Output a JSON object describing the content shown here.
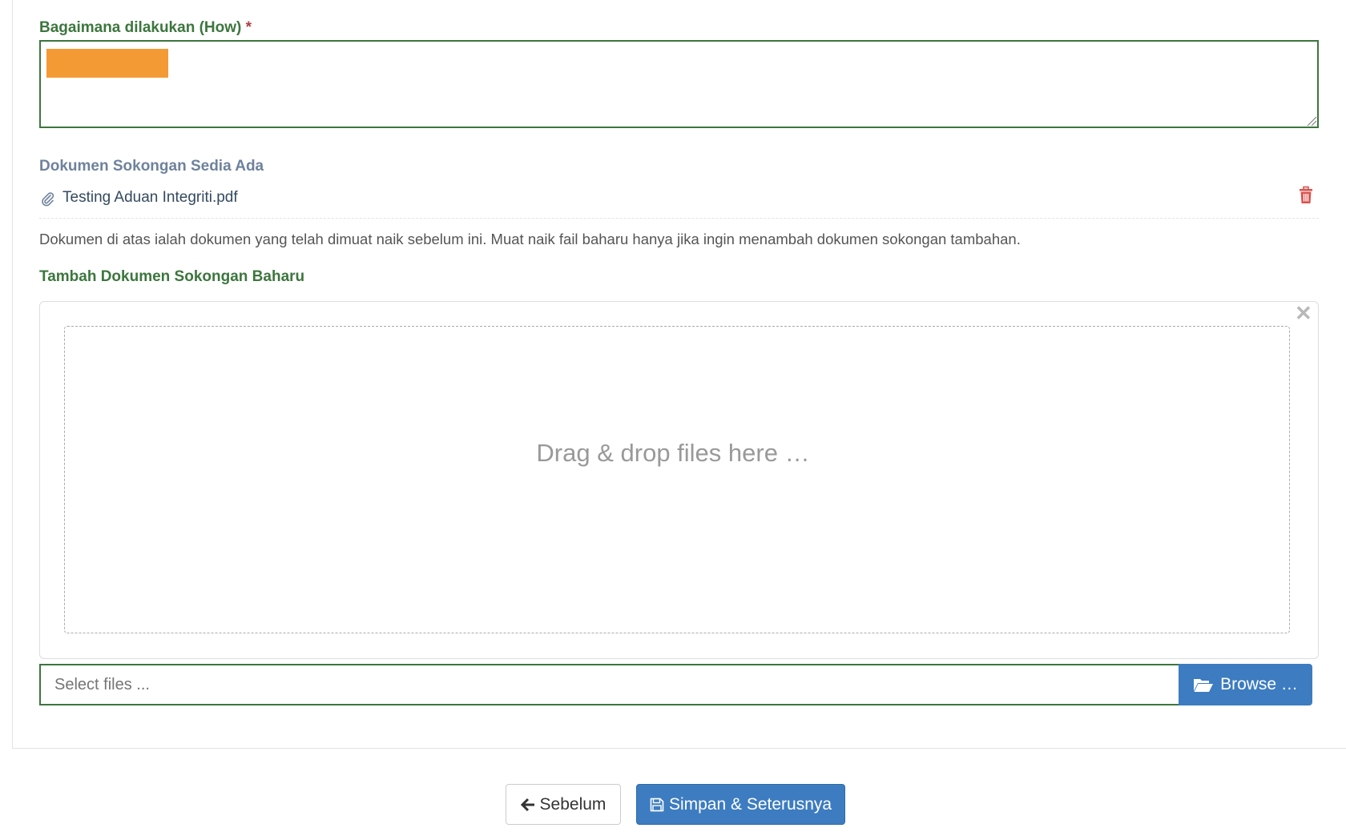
{
  "how_field": {
    "label": "Bagaimana dilakukan (How)",
    "required_marker": "*",
    "redaction_color": "#f39a35"
  },
  "existing_docs": {
    "heading": "Dokumen Sokongan Sedia Ada",
    "files": [
      {
        "name": "Testing Aduan Integriti.pdf"
      }
    ],
    "help_text": "Dokumen di atas ialah dokumen yang telah dimuat naik sebelum ini. Muat naik fail baharu hanya jika ingin menambah dokumen sokongan tambahan."
  },
  "new_docs": {
    "heading": "Tambah Dokumen Sokongan Baharu",
    "dropzone_text": "Drag & drop files here …",
    "input_placeholder": "Select files ...",
    "browse_label": "Browse …"
  },
  "actions": {
    "prev_label": "Sebelum",
    "save_label": "Simpan & Seterusnya"
  },
  "colors": {
    "label_green": "#3c763d",
    "primary_blue": "#3d7cc0",
    "danger_red": "#d9534f"
  },
  "icons": {
    "paperclip": "paperclip-icon",
    "trash": "trash-icon",
    "close": "close-icon",
    "folder_open": "folder-open-icon",
    "arrow_left": "arrow-left-icon",
    "save": "save-icon"
  }
}
